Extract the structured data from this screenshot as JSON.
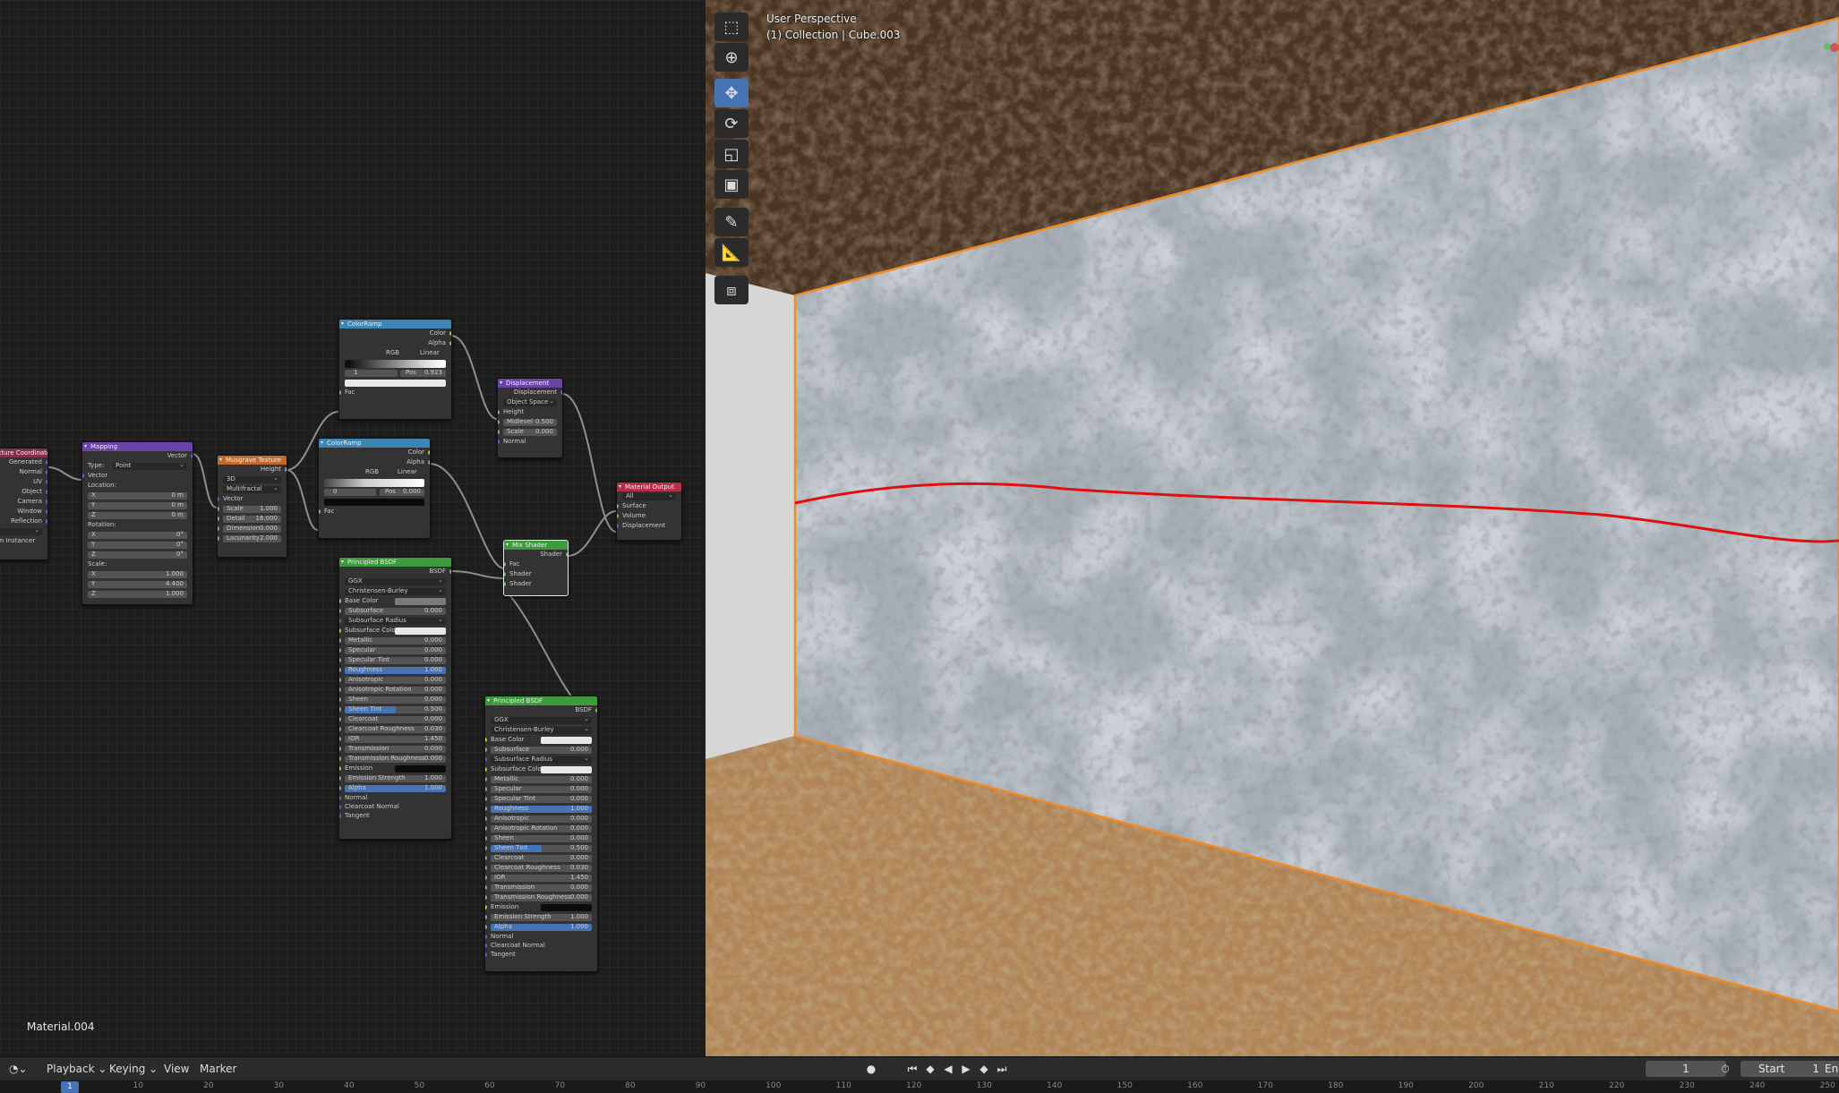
{
  "node_editor": {
    "material_name": "Material.004",
    "nodes": {
      "texcoord": {
        "title": "Texture Coordinate",
        "outputs": [
          "Generated",
          "Normal",
          "UV",
          "Object",
          "Camera",
          "Window",
          "Reflection"
        ],
        "footer": "From Instancer"
      },
      "mapping": {
        "title": "Mapping",
        "output": "Vector",
        "type_label": "Type:",
        "type_value": "Point",
        "vector": "Vector",
        "location": "Location:",
        "loc": [
          [
            "X",
            "0 m"
          ],
          [
            "Y",
            "0 m"
          ],
          [
            "Z",
            "0 m"
          ]
        ],
        "rotation": "Rotation:",
        "rot": [
          [
            "X",
            "0°"
          ],
          [
            "Y",
            "0°"
          ],
          [
            "Z",
            "0°"
          ]
        ],
        "scale": "Scale:",
        "scl": [
          [
            "X",
            "1.000"
          ],
          [
            "Y",
            "4.400"
          ],
          [
            "Z",
            "1.000"
          ]
        ]
      },
      "musgrave": {
        "title": "Musgrave Texture",
        "output": "Height",
        "dim": "3D",
        "mode": "Multifractal",
        "vector": "Vector",
        "params": [
          [
            "Scale",
            "1.000"
          ],
          [
            "Detail",
            "16.000"
          ],
          [
            "Dimension",
            "0.000"
          ],
          [
            "Lacunarity",
            "2.000"
          ]
        ]
      },
      "ramp1": {
        "title": "ColorRamp",
        "outputs": [
          "Color",
          "Alpha"
        ],
        "mode": "RGB",
        "interp": "Linear",
        "index": "1",
        "pos_label": "Pos",
        "pos": "0.923",
        "fac": "Fac"
      },
      "ramp2": {
        "title": "ColorRamp",
        "outputs": [
          "Color",
          "Alpha"
        ],
        "mode": "RGB",
        "interp": "Linear",
        "index": "0",
        "pos_label": "Pos",
        "pos": "0.000",
        "fac": "Fac"
      },
      "displacement": {
        "title": "Displacement",
        "output": "Displacement",
        "space": "Object Space",
        "height": "Height",
        "params": [
          [
            "Midlevel",
            "0.500"
          ],
          [
            "Scale",
            "0.000"
          ]
        ],
        "normal": "Normal"
      },
      "material_output": {
        "title": "Material Output",
        "target": "All",
        "inputs": [
          "Surface",
          "Volume",
          "Displacement"
        ]
      },
      "mix": {
        "title": "Mix Shader",
        "output": "Shader",
        "inputs": [
          "Fac",
          "Shader",
          "Shader"
        ]
      },
      "bsdf1": {
        "title": "Principled BSDF",
        "output": "BSDF",
        "dist": "GGX",
        "sss": "Christensen-Burley",
        "rows": [
          [
            "Base Color",
            "",
            "color"
          ],
          [
            "Subsurface",
            "0.000",
            ""
          ],
          [
            "Subsurface Radius",
            "",
            "dd"
          ],
          [
            "Subsurface Color",
            "",
            "white"
          ],
          [
            "Metallic",
            "0.000",
            ""
          ],
          [
            "Specular",
            "0.000",
            ""
          ],
          [
            "Specular Tint",
            "0.000",
            ""
          ],
          [
            "Roughness",
            "1.000",
            "hl"
          ],
          [
            "Anisotropic",
            "0.000",
            ""
          ],
          [
            "Anisotropic Rotation",
            "0.000",
            ""
          ],
          [
            "Sheen",
            "0.000",
            ""
          ],
          [
            "Sheen Tint",
            "0.500",
            "half"
          ],
          [
            "Clearcoat",
            "0.000",
            ""
          ],
          [
            "Clearcoat Roughness",
            "0.030",
            ""
          ],
          [
            "IOR",
            "1.450",
            ""
          ],
          [
            "Transmission",
            "0.000",
            ""
          ],
          [
            "Transmission Roughness",
            "0.000",
            ""
          ],
          [
            "Emission",
            "",
            "black"
          ],
          [
            "Emission Strength",
            "1.000",
            ""
          ],
          [
            "Alpha",
            "1.000",
            "hl"
          ]
        ],
        "vec": [
          "Normal",
          "Clearcoat Normal",
          "Tangent"
        ]
      },
      "bsdf2": {
        "title": "Principled BSDF",
        "output": "BSDF",
        "dist": "GGX",
        "sss": "Christensen-Burley",
        "rows": [
          [
            "Base Color",
            "",
            "white"
          ],
          [
            "Subsurface",
            "0.000",
            ""
          ],
          [
            "Subsurface Radius",
            "",
            "dd"
          ],
          [
            "Subsurface Color",
            "",
            "white"
          ],
          [
            "Metallic",
            "0.000",
            ""
          ],
          [
            "Specular",
            "0.000",
            ""
          ],
          [
            "Specular Tint",
            "0.000",
            ""
          ],
          [
            "Roughness",
            "1.000",
            "hl"
          ],
          [
            "Anisotropic",
            "0.000",
            ""
          ],
          [
            "Anisotropic Rotation",
            "0.000",
            ""
          ],
          [
            "Sheen",
            "0.000",
            ""
          ],
          [
            "Sheen Tint",
            "0.500",
            "half"
          ],
          [
            "Clearcoat",
            "0.000",
            ""
          ],
          [
            "Clearcoat Roughness",
            "0.030",
            ""
          ],
          [
            "IOR",
            "1.450",
            ""
          ],
          [
            "Transmission",
            "0.000",
            ""
          ],
          [
            "Transmission Roughness",
            "0.000",
            ""
          ],
          [
            "Emission",
            "",
            "black"
          ],
          [
            "Emission Strength",
            "1.000",
            ""
          ],
          [
            "Alpha",
            "1.000",
            "hl"
          ]
        ],
        "vec": [
          "Normal",
          "Clearcoat Normal",
          "Tangent"
        ]
      }
    }
  },
  "viewport": {
    "perspective": "User Perspective",
    "object": "(1) Collection | Cube.003",
    "tools": [
      "select-box-icon",
      "cursor-icon",
      "move-icon",
      "rotate-icon",
      "scale-icon",
      "transform-icon",
      "annotate-icon",
      "measure-icon",
      "add-cube-icon"
    ],
    "active_tool": "move-icon",
    "colors": {
      "ceiling": "#4a3524",
      "wall": "#9aa3ab",
      "floor": "#b08456",
      "outline": "#f08a24",
      "stroke": "#e01010",
      "side_wall": "#d4d4d4"
    }
  },
  "timeline": {
    "menus": [
      "Playback",
      "Keying",
      "View",
      "Marker"
    ],
    "current_frame": "1",
    "start_label": "Start",
    "start_value": "1",
    "end_label": "En",
    "ruler": [
      "1",
      "10",
      "20",
      "30",
      "40",
      "50",
      "60",
      "70",
      "80",
      "90",
      "100",
      "110",
      "120",
      "130",
      "140",
      "150",
      "160",
      "170",
      "180",
      "190",
      "200",
      "210",
      "220",
      "230",
      "240",
      "250"
    ]
  }
}
